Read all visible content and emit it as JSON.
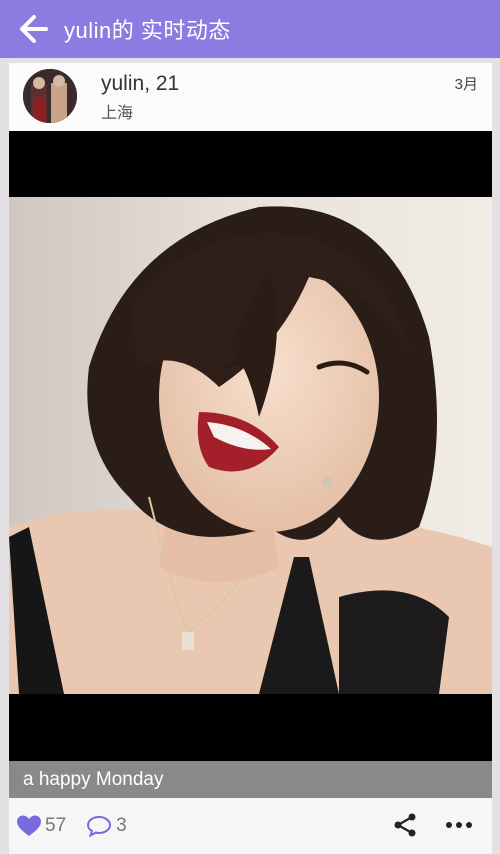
{
  "app_bar": {
    "title": "yulin的 实时动态",
    "back_icon": "arrow-left-icon",
    "color": "#8c7be0"
  },
  "post": {
    "username_age": "yulin, 21",
    "location": "上海",
    "date": "3月",
    "caption": "a happy Monday",
    "likes": "57",
    "comments": "3",
    "icons": {
      "like": "heart-icon",
      "comment": "comment-bubble-icon",
      "share": "share-icon",
      "more": "more-dots-icon"
    },
    "accent_color": "#7a6ae0"
  }
}
